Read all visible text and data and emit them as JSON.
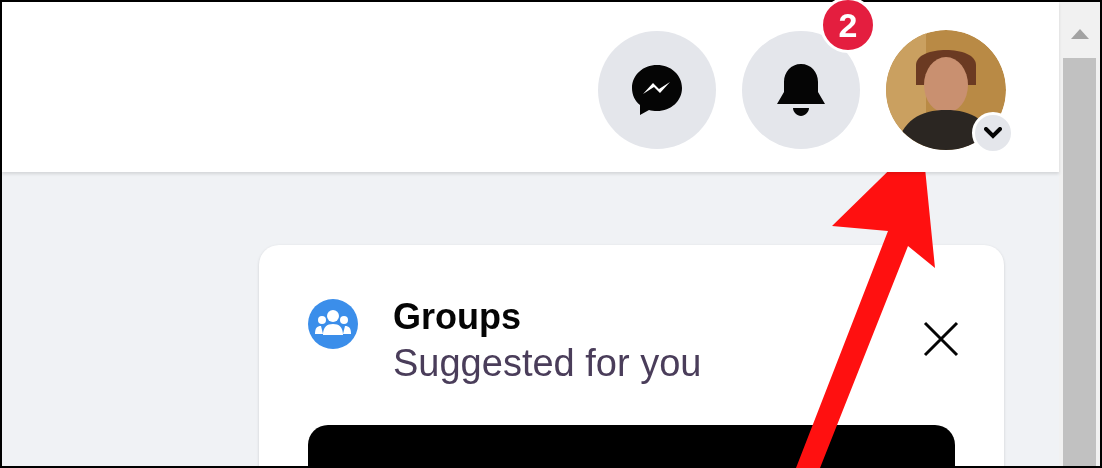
{
  "header": {
    "notification_count": "2"
  },
  "groups_card": {
    "title": "Groups",
    "subtitle": "Suggested for you"
  }
}
